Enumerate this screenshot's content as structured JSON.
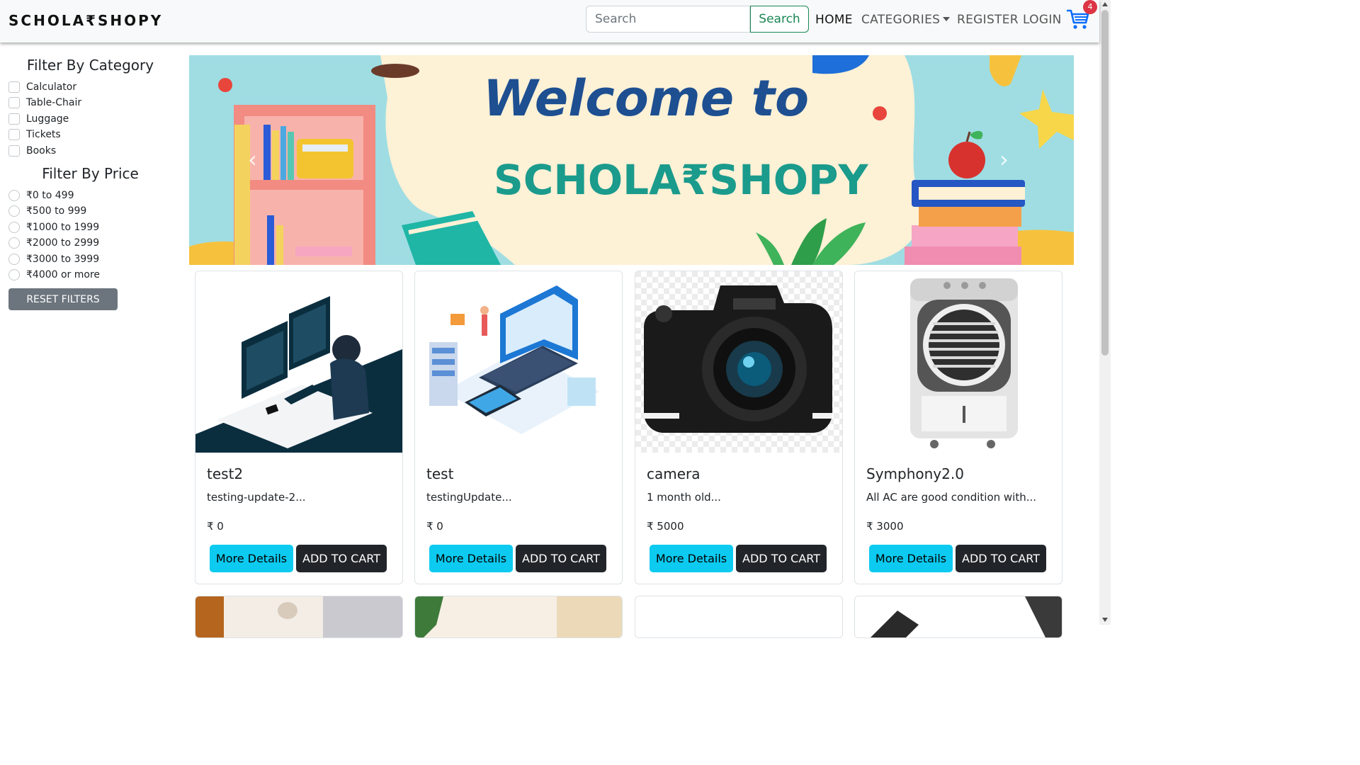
{
  "navbar": {
    "brand": "SCHOLA₹SHOPY",
    "search_placeholder": "Search",
    "search_button": "Search",
    "links": {
      "home": "HOME",
      "categories": "CATEGORIES",
      "register": "REGISTER",
      "login": "LOGIN"
    },
    "cart_count": "4"
  },
  "sidebar": {
    "category_title": "Filter By Category",
    "categories": [
      "Calculator",
      "Table-Chair",
      "Luggage",
      "Tickets",
      "Books"
    ],
    "price_title": "Filter By Price",
    "prices": [
      "₹0 to 499",
      "₹500 to 999",
      "₹1000 to 1999",
      "₹2000 to 2999",
      "₹3000 to 3999",
      "₹4000 or more"
    ],
    "reset_button": "RESET FILTERS"
  },
  "banner": {
    "line1": "Welcome to",
    "line2": "SCHOLA₹SHOPY"
  },
  "products": [
    {
      "name": "test2",
      "description": "testing-update-2...",
      "price": "₹ 0",
      "details_button": "More Details",
      "cart_button": "ADD TO CART"
    },
    {
      "name": "test",
      "description": "testingUpdate...",
      "price": "₹ 0",
      "details_button": "More Details",
      "cart_button": "ADD TO CART"
    },
    {
      "name": "camera",
      "description": "1 month old...",
      "price": "₹ 5000",
      "details_button": "More Details",
      "cart_button": "ADD TO CART"
    },
    {
      "name": "Symphony2.0",
      "description": "All AC are good condition with...",
      "price": "₹ 3000",
      "details_button": "More Details",
      "cart_button": "ADD TO CART"
    }
  ],
  "colors": {
    "accent_info": "#0dcaf0",
    "dark_button": "#212529",
    "success": "#198754",
    "badge": "#dc3545",
    "cart_icon": "#0d6efd"
  }
}
